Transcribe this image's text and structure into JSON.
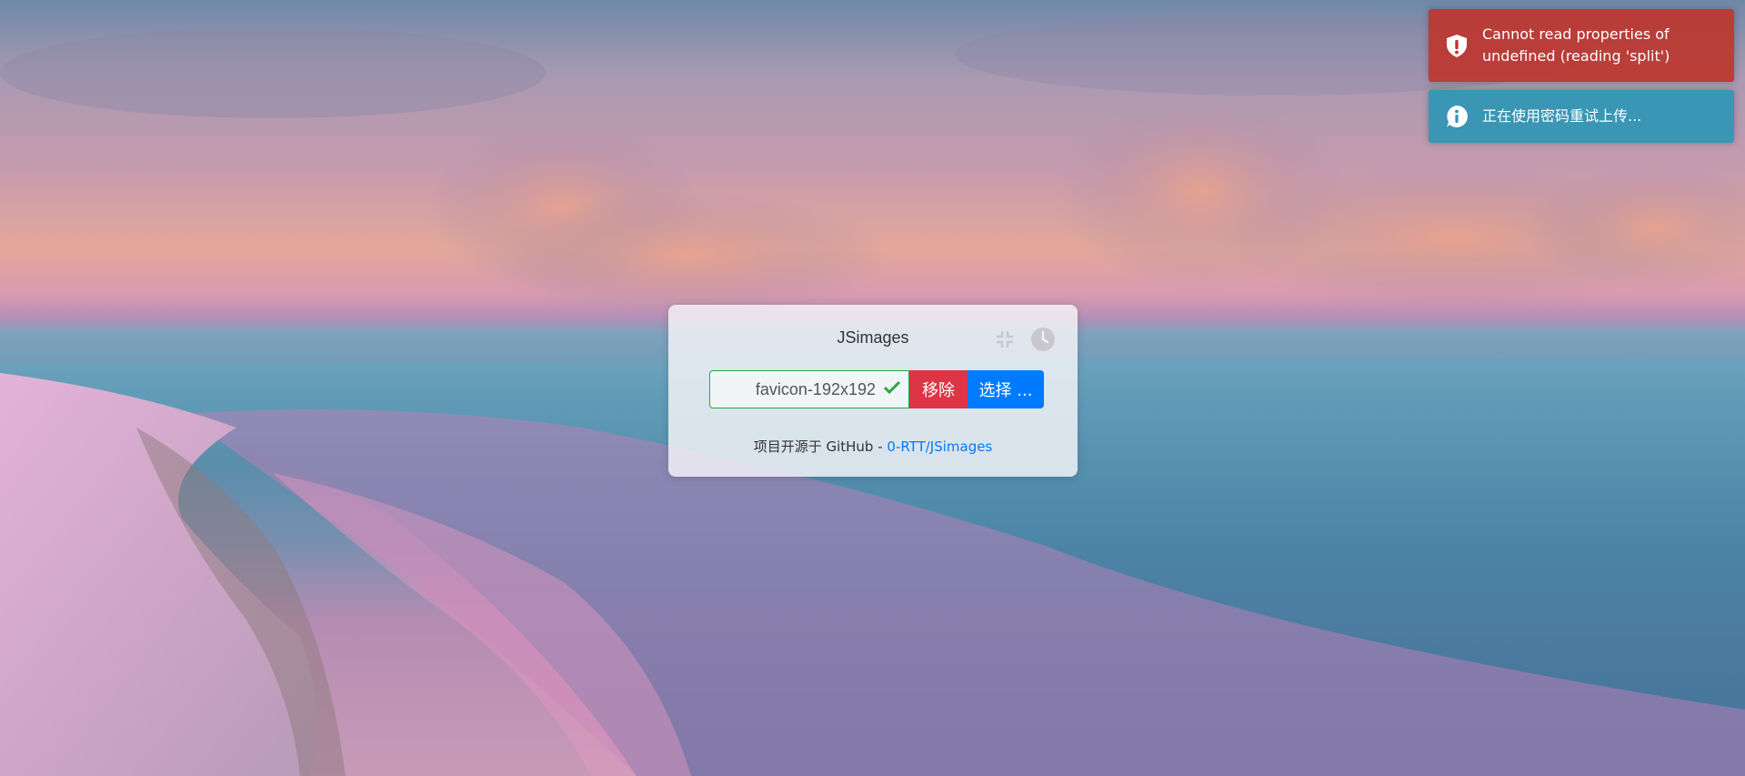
{
  "app": {
    "title": "JSimages"
  },
  "upload": {
    "file_name": "favicon-192x192",
    "remove_label": "移除",
    "choose_label": "选择 ..."
  },
  "footer": {
    "prefix": "项目开源于 GitHub - ",
    "link_text": "0-RTT/JSimages"
  },
  "toasts": [
    {
      "type": "error",
      "message": "Cannot read properties of undefined (reading 'split')",
      "icon": "shield-exclamation-icon",
      "color": "#bd362f"
    },
    {
      "type": "info",
      "message": "正在使用密码重试上传...",
      "icon": "info-icon",
      "color": "#2f96b4"
    }
  ],
  "colors": {
    "success_border": "#28a745",
    "danger": "#dc3545",
    "primary": "#007bff"
  }
}
